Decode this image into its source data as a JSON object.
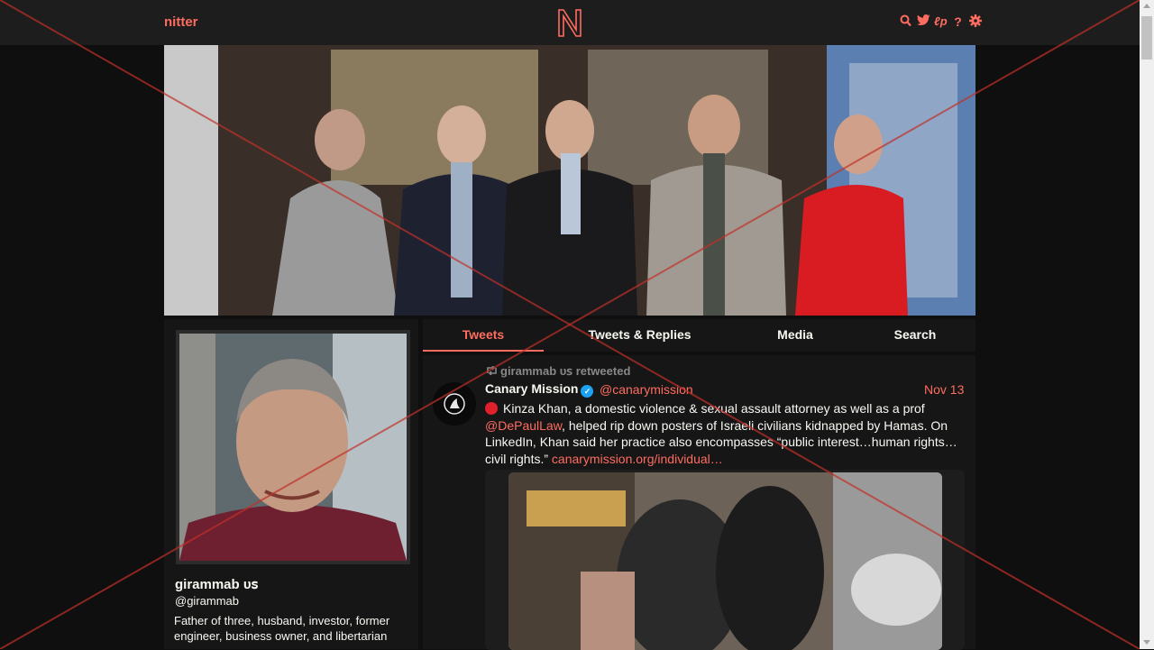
{
  "nav": {
    "brand": "nitter",
    "logo_letter": "N",
    "icons": [
      "search-icon",
      "twitter-icon",
      "rss-icon",
      "help-icon",
      "settings-icon"
    ],
    "icon_glyphs": {
      "search": "⌕",
      "twitter": "🐦",
      "rss": "ℓp",
      "help": "?",
      "settings": "⚙"
    }
  },
  "profile": {
    "fullname": "girammab ᴜꜱ",
    "username": "@girammab",
    "bio": "Father of three, husband, investor, former engineer, business owner, and libertarian"
  },
  "tabs": [
    {
      "label": "Tweets",
      "active": true
    },
    {
      "label": "Tweets & Replies",
      "active": false
    },
    {
      "label": "Media",
      "active": false
    },
    {
      "label": "Search",
      "active": false
    }
  ],
  "tweet": {
    "retweet_label": "girammab ᴜꜱ retweeted",
    "author_name": "Canary Mission",
    "author_handle": "@canarymission",
    "date": "Nov 13",
    "text_before_mention": "Kinza Khan, a domestic violence & sexual assault attorney as well as a prof ",
    "mention": "@DePaulLaw",
    "text_after_mention": ", helped rip down posters of Israeli civilians kidnapped by Hamas. On LinkedIn, Khan said her practice also encompasses “public interest…human rights…civil rights.” ",
    "link": "canarymission.org/individual…"
  },
  "colors": {
    "accent": "#ff6c60",
    "background": "#0f0f0f",
    "panel": "#161616",
    "navbar": "#1d1d1d",
    "verified": "#1da1f2"
  }
}
